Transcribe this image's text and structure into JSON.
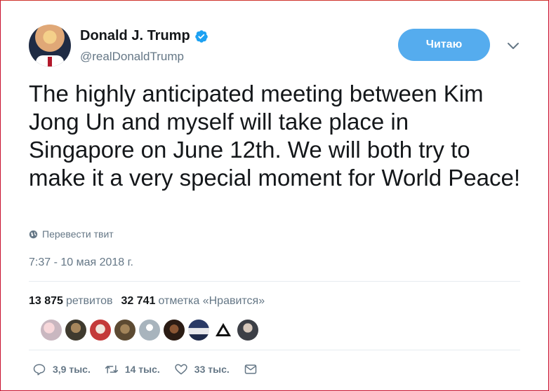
{
  "author": {
    "name": "Donald J. Trump",
    "handle": "@realDonaldTrump",
    "verified": true
  },
  "follow_button": {
    "label": "Читаю",
    "color": "#55acee"
  },
  "tweet": {
    "text": "The highly anticipated meeting between Kim Jong Un and myself will take place in Singapore on June 12th. We will both try to make it a very special moment for World Peace!",
    "translate_label": "Перевести твит",
    "timestamp": "7:37 - 10 мая 2018 г."
  },
  "stats": {
    "retweets_count": "13 875",
    "retweets_label": "ретвитов",
    "likes_count": "32 741",
    "likes_label": "отметка «Нравится»"
  },
  "liker_avatars": 9,
  "actions": {
    "replies": "3,9 тыс.",
    "retweets": "14 тыс.",
    "likes": "33 тыс."
  },
  "icons": [
    "verified-badge-icon",
    "chevron-down-icon",
    "globe-icon",
    "reply-icon",
    "retweet-icon",
    "heart-icon",
    "envelope-icon"
  ]
}
